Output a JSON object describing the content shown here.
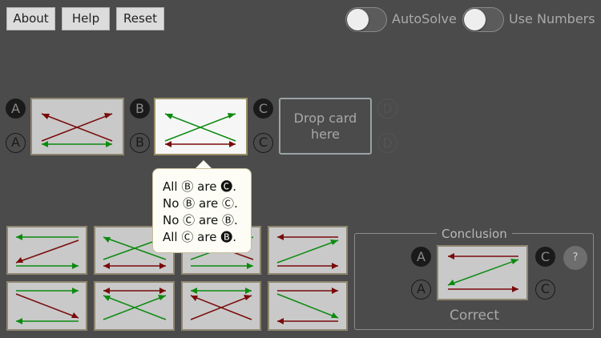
{
  "toolbar": {
    "about": "About",
    "help": "Help",
    "reset": "Reset"
  },
  "toggles": {
    "autosolve": {
      "label": "AutoSolve",
      "on": false
    },
    "use_numbers": {
      "label": "Use Numbers",
      "on": false
    }
  },
  "slot_labels": {
    "A": "A",
    "B": "B",
    "C": "C",
    "D": "D"
  },
  "dropzone": {
    "line1": "Drop card",
    "line2": "here"
  },
  "popup": {
    "lines": [
      {
        "pre": "All ",
        "s1": "B",
        "mid": " are ",
        "s2": "C",
        "s2_filled": true,
        "post": "."
      },
      {
        "pre": "No ",
        "s1": "B",
        "mid": " are ",
        "s2": "C",
        "s2_filled": false,
        "post": "."
      },
      {
        "pre": "No ",
        "s1": "C",
        "mid": " are ",
        "s2": "B",
        "s2_filled": false,
        "post": "."
      },
      {
        "pre": "All ",
        "s1": "C",
        "mid": " are ",
        "s2": "B",
        "s2_filled": true,
        "post": "."
      }
    ]
  },
  "conclusion": {
    "title": "Conclusion",
    "status": "Correct",
    "help": "?"
  },
  "colors": {
    "red_arrow": "#7a0a0a",
    "green_arrow": "#0c8a10",
    "bg": "#4b4b4b"
  }
}
